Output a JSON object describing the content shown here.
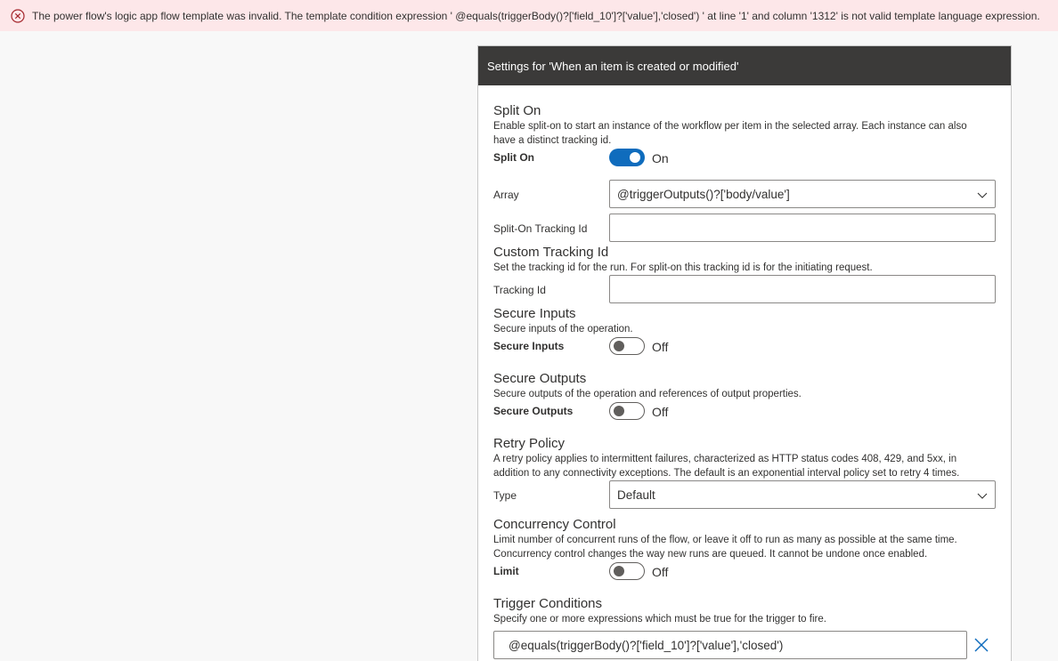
{
  "error_banner": {
    "icon": "error-circle-icon",
    "message": "The power flow's logic app flow template was invalid. The template condition expression ' @equals(triggerBody()?['field_10']?['value'],'closed') ' at line '1' and column '1312' is not valid template language expression."
  },
  "panel": {
    "title": "Settings for 'When an item is created or modified'",
    "split_on": {
      "title": "Split On",
      "description_line1": "Enable split-on to start an instance of the workflow per item in the selected array. Each instance can also",
      "description_line2": "have a distinct tracking id.",
      "toggle_label": "Split On",
      "toggle_state": "On",
      "array_label": "Array",
      "array_value": "@triggerOutputs()?['body/value']",
      "tracking_label": "Split-On Tracking Id",
      "tracking_value": ""
    },
    "custom_tracking": {
      "title": "Custom Tracking Id",
      "description": "Set the tracking id for the run. For split-on this tracking id is for the initiating request.",
      "label": "Tracking Id",
      "value": ""
    },
    "secure_inputs": {
      "title": "Secure Inputs",
      "description": "Secure inputs of the operation.",
      "toggle_label": "Secure Inputs",
      "toggle_state": "Off"
    },
    "secure_outputs": {
      "title": "Secure Outputs",
      "description": "Secure outputs of the operation and references of output properties.",
      "toggle_label": "Secure Outputs",
      "toggle_state": "Off"
    },
    "retry_policy": {
      "title": "Retry Policy",
      "description_line1": "A retry policy applies to intermittent failures, characterized as HTTP status codes 408, 429, and 5xx, in",
      "description_line2": "addition to any connectivity exceptions. The default is an exponential interval policy set to retry 4 times.",
      "type_label": "Type",
      "type_value": "Default"
    },
    "concurrency": {
      "title": "Concurrency Control",
      "description_line1": "Limit number of concurrent runs of the flow, or leave it off to run as many as possible at the same time.",
      "description_line2": "Concurrency control changes the way new runs are queued. It cannot be undone once enabled.",
      "toggle_label": "Limit",
      "toggle_state": "Off"
    },
    "trigger_conditions": {
      "title": "Trigger Conditions",
      "description": "Specify one or more expressions which must be true for the trigger to fire.",
      "condition_value": "@equals(triggerBody()?['field_10']?['value'],'closed')"
    }
  },
  "colors": {
    "error_background": "#fde7e9",
    "error_icon": "#a4262c",
    "header_background": "#3b3a39",
    "toggle_on": "#0f6cbd",
    "remove_icon": "#0f6cbd"
  }
}
